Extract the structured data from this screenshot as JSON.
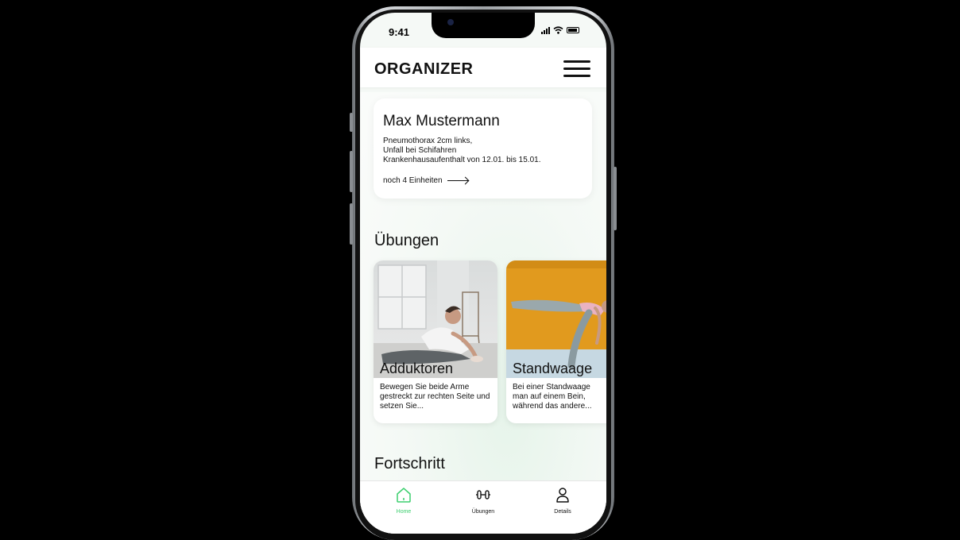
{
  "status_bar": {
    "time": "9:41"
  },
  "header": {
    "title": "ORGANIZER"
  },
  "patient": {
    "name": "Max Mustermann",
    "lines": [
      "Pneumothorax 2cm links,",
      "Unfall bei Schifahren",
      "Krankenhausaufenthalt von 12.01. bis 15.01."
    ],
    "remaining": "noch 4 Einheiten"
  },
  "sections": {
    "exercises": "Übungen",
    "progress": "Fortschritt"
  },
  "exercises": [
    {
      "name": "Adduktoren",
      "description": "Bewegen Sie beide Arme gestreckt zur rechten Seite und setzen Sie..."
    },
    {
      "name": "Standwaage",
      "description": "Bei einer Standwaage man auf einem Bein, während das andere..."
    }
  ],
  "tabbar": {
    "items": [
      {
        "label": "Home",
        "icon": "home-icon",
        "active": true
      },
      {
        "label": "Übungen",
        "icon": "dumbbell-icon",
        "active": false
      },
      {
        "label": "Details",
        "icon": "person-icon",
        "active": false
      }
    ]
  },
  "colors": {
    "accent": "#3ccf6e",
    "background": "#000000"
  }
}
